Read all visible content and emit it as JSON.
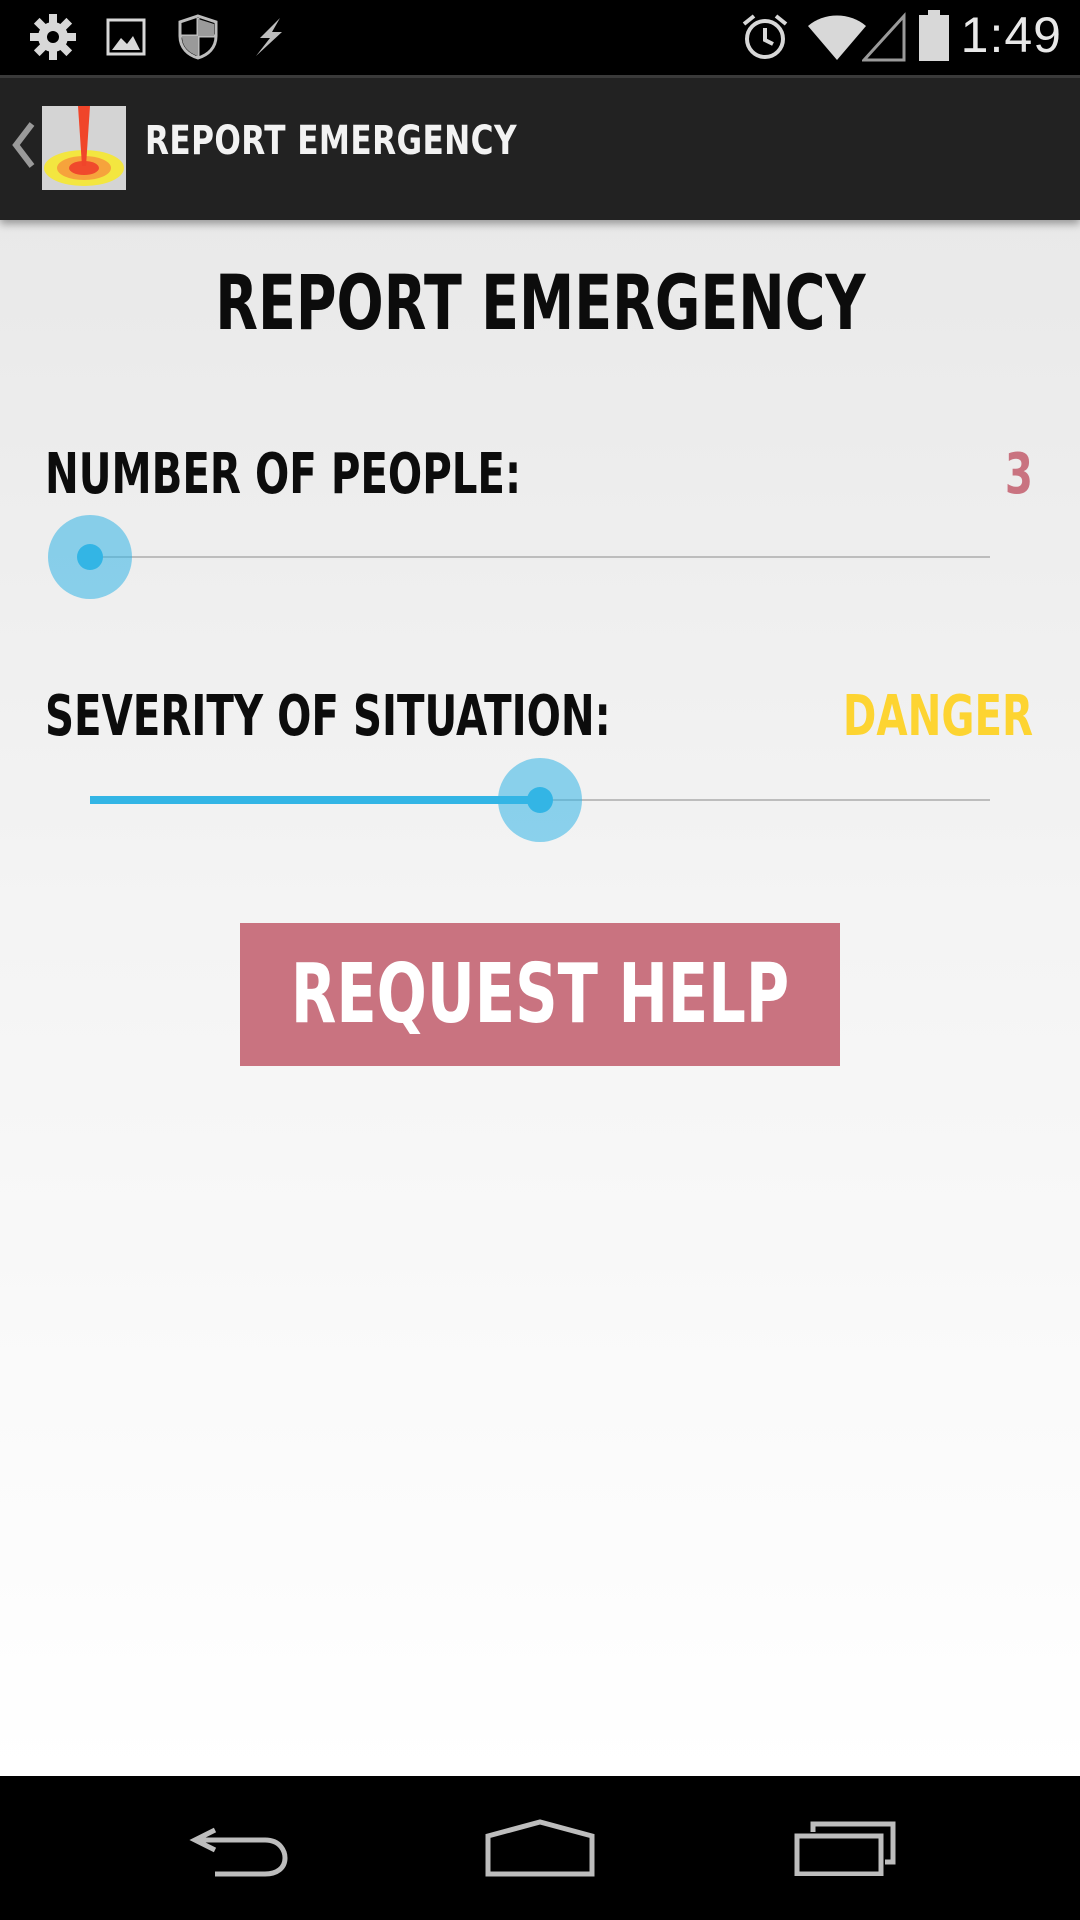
{
  "status_bar": {
    "time": "1:49",
    "left_icons": [
      "settings-icon",
      "gallery-icon",
      "shield-icon",
      "bolt-icon"
    ],
    "right_icons": [
      "alarm-icon",
      "wifi-icon",
      "signal-icon",
      "battery-icon"
    ]
  },
  "action_bar": {
    "title": "REPORT EMERGENCY",
    "app_icon": "emergency-app-icon",
    "back_icon": "chevron-left-icon"
  },
  "main": {
    "title": "REPORT EMERGENCY",
    "people": {
      "label": "NUMBER OF PEOPLE:",
      "value": "3",
      "value_color": "#c97380",
      "slider_fraction": 0.0
    },
    "severity": {
      "label": "SEVERITY OF SITUATION:",
      "value": "DANGER",
      "value_color": "#fdd431",
      "slider_fraction": 0.5
    },
    "request_button": {
      "label": "REQUEST HELP",
      "color": "#c97380"
    }
  },
  "nav_bar": {
    "icons": [
      "back-icon",
      "home-icon",
      "recents-icon"
    ]
  },
  "colors": {
    "accent": "#33b5e5",
    "action_bar": "#222222"
  }
}
